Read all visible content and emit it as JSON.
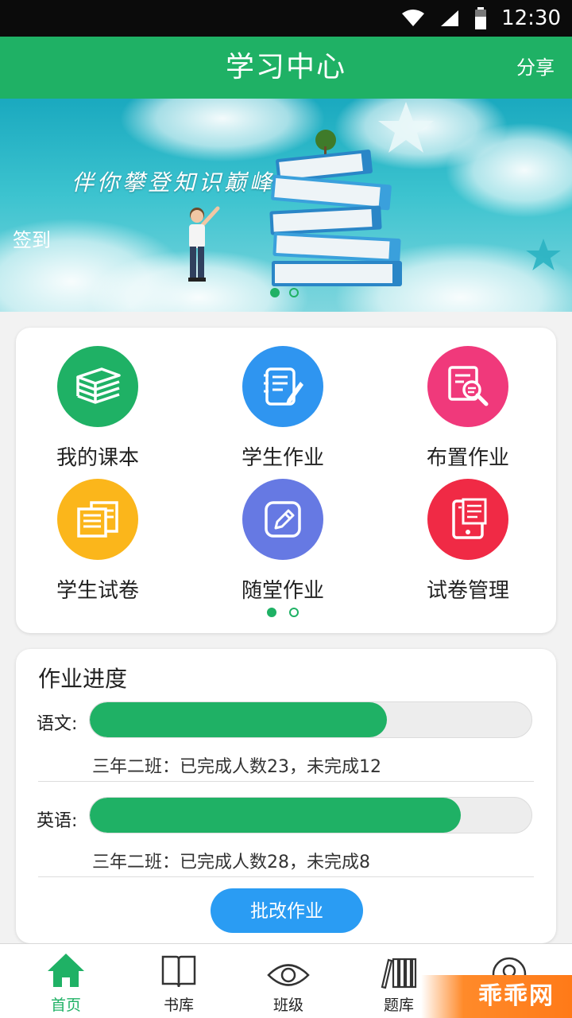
{
  "status_bar": {
    "time": "12:30"
  },
  "app_bar": {
    "title": "学习中心",
    "share_label": "分享"
  },
  "banner": {
    "slogan": "伴你攀登知识巅峰",
    "checkin_label": "签到",
    "page_count": 2,
    "active_page": 1
  },
  "grid": {
    "items": [
      {
        "label": "我的课本",
        "icon": "textbook-icon",
        "color": "#1fb165"
      },
      {
        "label": "学生作业",
        "icon": "notebook-icon",
        "color": "#2f95f0"
      },
      {
        "label": "布置作业",
        "icon": "document-search-icon",
        "color": "#f0397b"
      },
      {
        "label": "学生试卷",
        "icon": "papers-icon",
        "color": "#fbb61b"
      },
      {
        "label": "随堂作业",
        "icon": "edit-icon",
        "color": "#6679e3"
      },
      {
        "label": "试卷管理",
        "icon": "exam-management-icon",
        "color": "#f02a45"
      }
    ],
    "page_count": 2,
    "active_page": 1
  },
  "progress": {
    "heading": "作业进度",
    "subjects": [
      {
        "label": "语文:",
        "fraction": 0.672,
        "note": "三年二班：已完成人数23，未完成12"
      },
      {
        "label": "英语:",
        "fraction": 0.84,
        "note": "三年二班：已完成人数28，未完成8"
      }
    ],
    "button_label": "批改作业"
  },
  "tabs": [
    {
      "label": "首页",
      "icon": "home-icon",
      "active": true
    },
    {
      "label": "书库",
      "icon": "book-icon",
      "active": false
    },
    {
      "label": "班级",
      "icon": "eye-icon",
      "active": false
    },
    {
      "label": "题库",
      "icon": "bookshelf-icon",
      "active": false
    },
    {
      "label": "",
      "icon": "profile-icon",
      "active": false
    }
  ],
  "watermark": "乖乖网",
  "colors": {
    "primary": "#1fb165",
    "button": "#2a9cf3"
  }
}
